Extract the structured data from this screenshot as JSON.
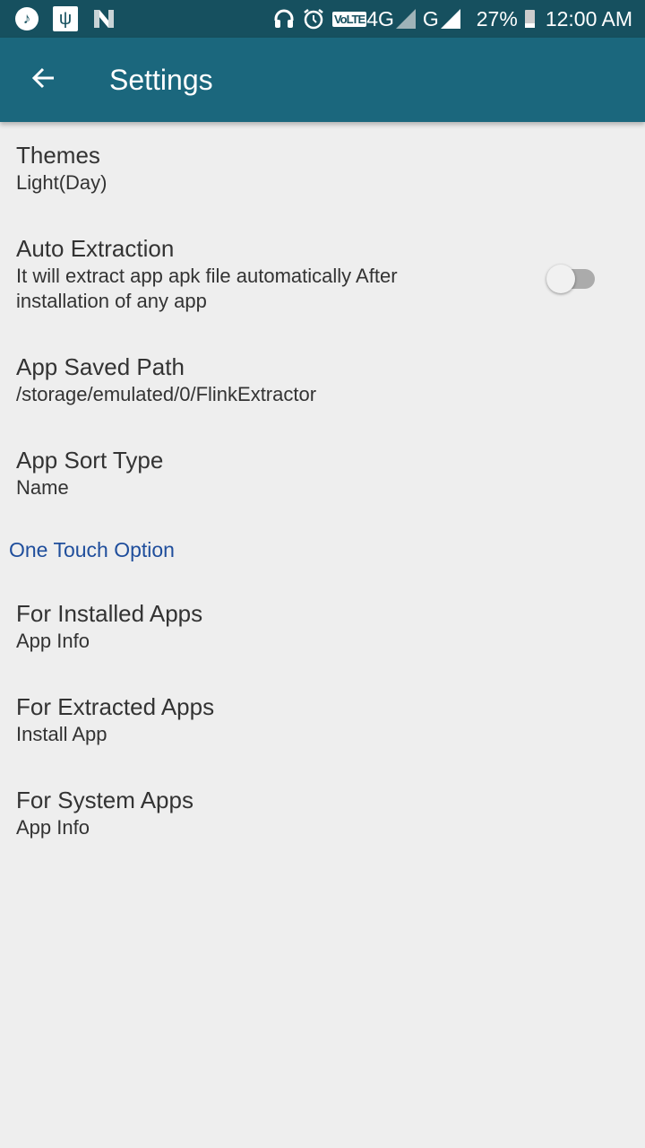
{
  "status_bar": {
    "left_icons": [
      "music-notification-icon",
      "usb-icon",
      "n-notification-icon"
    ],
    "right_icons": [
      "headphones-icon",
      "alarm-icon",
      "volte-icon",
      "signal-4g-icon",
      "signal-g-icon",
      "battery-charging-icon"
    ],
    "volte_label": "VoLTE",
    "network_1": "4G",
    "network_2": "G",
    "battery": "27%",
    "time": "12:00 AM"
  },
  "app_bar": {
    "back_icon": "arrow-back-icon",
    "title": "Settings"
  },
  "colors": {
    "status_bar": "#16505f",
    "app_bar": "#1b677d",
    "background": "#eeeeee",
    "category_text": "#1f4e9c",
    "primary_text": "#333333",
    "switch_track_off": "#ababab"
  },
  "preferences": [
    {
      "title": "Themes",
      "summary": "Light(Day)"
    },
    {
      "title": "Auto Extraction",
      "summary": "It will extract app apk file automatically After installation of any app",
      "toggle": false
    },
    {
      "title": "App Saved Path",
      "summary": "/storage/emulated/0/FlinkExtractor"
    },
    {
      "title": "App Sort Type",
      "summary": "Name"
    }
  ],
  "category": {
    "title": "One Touch Option",
    "items": [
      {
        "title": "For Installed Apps",
        "summary": "App Info"
      },
      {
        "title": "For Extracted Apps",
        "summary": "Install App"
      },
      {
        "title": "For System Apps",
        "summary": "App Info"
      }
    ]
  }
}
